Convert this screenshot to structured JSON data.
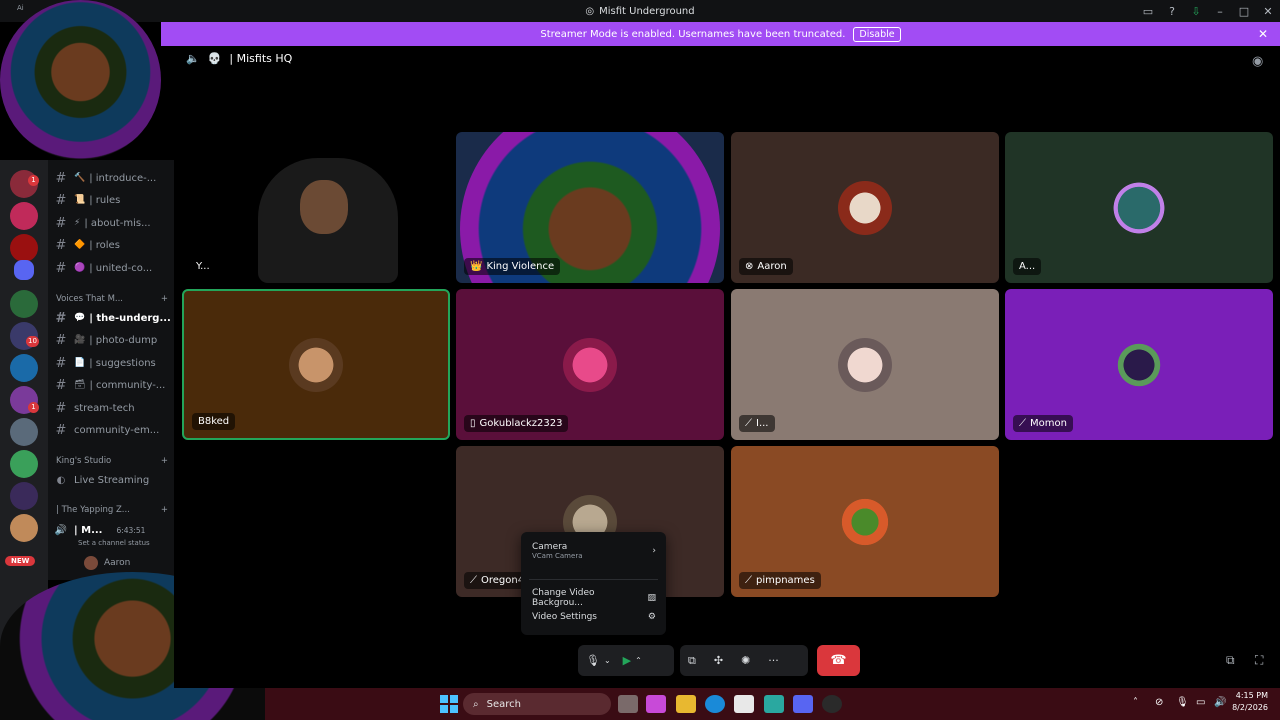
{
  "window": {
    "title": "Misfit Underground",
    "corner_label": "Ai"
  },
  "banner": {
    "text": "Streamer Mode is enabled. Usernames have been truncated.",
    "button": "Disable"
  },
  "voice": {
    "channel": "| Misfits HQ"
  },
  "channels": [
    {
      "emoji": "🔨",
      "label": "| introduce-..."
    },
    {
      "emoji": "📜",
      "label": "| rules"
    },
    {
      "emoji": "⚡",
      "label": "| about-mis..."
    },
    {
      "emoji": "🔶",
      "label": "| roles"
    },
    {
      "emoji": "🟣",
      "label": "| united-co..."
    }
  ],
  "category_voices": "Voices That M...",
  "channels2": [
    {
      "emoji": "💬",
      "label": "| the-underg...",
      "selected": true
    },
    {
      "emoji": "🎥",
      "label": "| photo-dump"
    },
    {
      "emoji": "📄",
      "label": "| suggestions"
    },
    {
      "emoji": "🗃",
      "label": "| community-..."
    },
    {
      "emoji": "",
      "label": "stream-tech"
    },
    {
      "emoji": "",
      "label": "community-em..."
    }
  ],
  "category_kings": "King's Studio",
  "live_streaming": "Live Streaming",
  "category_yapping": "| The Yapping Z...",
  "active_voice": {
    "name": "| M...",
    "timer": "6:43:51",
    "status": "Set a channel status"
  },
  "voice_user": "Aaron",
  "rail_badges": [
    "1",
    "10",
    "1"
  ],
  "new_badge": "NEW",
  "tiles": [
    {
      "name": "Y...",
      "color": "#000000"
    },
    {
      "name": "King Violence",
      "color": "#1a2b4a"
    },
    {
      "name": "Aaron",
      "color": "#3b2a24"
    },
    {
      "name": "A...",
      "color": "#203426"
    },
    {
      "name": "B8ked",
      "color": "#4a2a0a"
    },
    {
      "name": "Gokublackz2323",
      "color": "#5a0f3a"
    },
    {
      "name": "I...",
      "color": "#8a7a72"
    },
    {
      "name": "Momon",
      "color": "#7a1fb8"
    },
    {
      "name": "Oregon4",
      "color": "#3d2a26"
    },
    {
      "name": "pimpnames",
      "color": "#8a4a24"
    }
  ],
  "menu": {
    "camera": "Camera",
    "camera_sub": "VCam Camera",
    "change_bg": "Change Video Backgrou...",
    "settings": "Video Settings"
  },
  "taskbar": {
    "search": "Search",
    "time": "4:15 PM",
    "date": "8/2/2026"
  }
}
